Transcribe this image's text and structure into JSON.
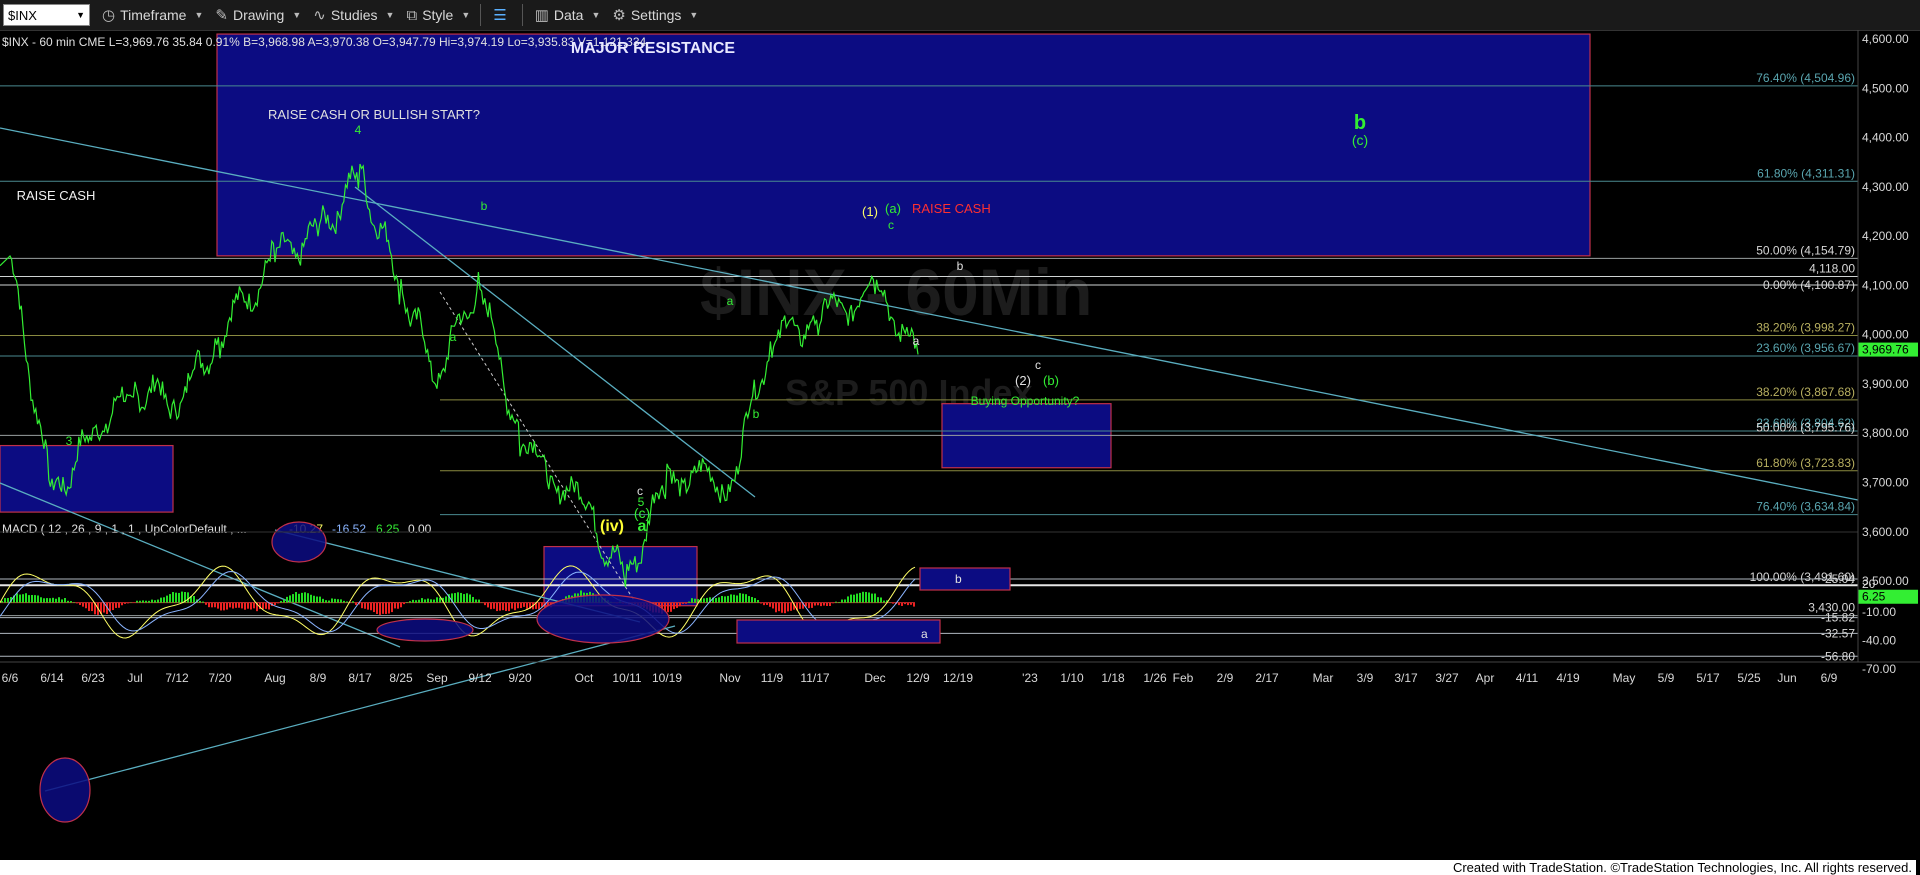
{
  "toolbar": {
    "symbol": "$INX",
    "timeframe": "Timeframe",
    "drawing": "Drawing",
    "studies": "Studies",
    "style": "Style",
    "data": "Data",
    "settings": "Settings"
  },
  "header": "$INX - 60 min CME  L=3,969.76  35.84  0.91%  B=3,968.98  A=3,970.38  O=3,947.79  Hi=3,974.19  Lo=3,935.83  V=1,121,334",
  "watermark": {
    "line1": "$INX - 60Min",
    "line2": "S&P 500 Index"
  },
  "colors": {
    "price": "#33ee33",
    "zone": "#0c0c82",
    "trend": "#5aaec0",
    "fib": "#4a7a84"
  },
  "annotations": {
    "major_resistance": "MAJOR RESISTANCE",
    "raise_cash_or_bullish": "RAISE CASH OR BULLISH START?",
    "raise_cash_left": "RAISE CASH",
    "raise_cash_right": "RAISE CASH",
    "buying_opportunity": "Buying Opportunity?",
    "w_4": "4",
    "w_3": "3",
    "w_b_sep": "b",
    "w_a_sep": "a",
    "w_c_oct": "c",
    "w_5_oct": "5",
    "w_c_paren_oct": "(c)",
    "w_iv": "(iv)",
    "w_a_big": "a",
    "w_a_nov": "a",
    "w_b_nov": "b",
    "w_1_paren": "(1)",
    "w_a_paren": "(a)",
    "w_c_dec": "c",
    "w_b_dec": "b",
    "w_a_dec": "a",
    "w_c_box": "c",
    "w_2_paren": "(2)",
    "w_b_paren": "(b)",
    "w_b_big": "b",
    "w_c_paren_big": "(c)"
  },
  "fibs": [
    {
      "label": "76.40% (4,504.96)",
      "value": 4504.96
    },
    {
      "label": "61.80% (4,311.31)",
      "value": 4311.31
    },
    {
      "label": "50.00% (4,154.79)",
      "value": 4154.79
    },
    {
      "label": "0.00% (4,100.87)",
      "value": 4100.87
    },
    {
      "label": "38.20% (3,998.27)",
      "value": 3998.27
    },
    {
      "label": "23.60% (3,956.67)",
      "value": 3956.67
    },
    {
      "label": "38.20% (3,867.68)",
      "value": 3867.68
    },
    {
      "label": "23.60% (3,804.62)",
      "value": 3804.62
    },
    {
      "label": "50.00% (3,795.76)",
      "value": 3795.76
    },
    {
      "label": "61.80% (3,723.83)",
      "value": 3723.83
    },
    {
      "label": "76.40% (3,634.84)",
      "value": 3634.84
    },
    {
      "label": "100.00% (3,491.60)",
      "value": 3491.6
    },
    {
      "label": "3,430.00",
      "value": 3430.0
    },
    {
      "label": "4,118.00",
      "value": 4118.0
    }
  ],
  "macd": {
    "title": "MACD ( 12 , 26 , 9 , 1 , 1 , UpColorDefault , ...",
    "v1": "-10.27",
    "v2": "-16.52",
    "v3": "6.25",
    "v4": "0.00",
    "levels": [
      {
        "label": "25.04",
        "value": 25.04
      },
      {
        "label": "-15.82",
        "value": -15.82
      },
      {
        "label": "-32.57",
        "value": -32.57
      },
      {
        "label": "-56.80",
        "value": -56.8
      }
    ],
    "box_b": "b",
    "box_a": "a",
    "ticks": [
      {
        "label": "20",
        "value": 20
      },
      {
        "label": "-10.00",
        "value": -10
      },
      {
        "label": "-40.00",
        "value": -40
      },
      {
        "label": "-70.00",
        "value": -70
      }
    ],
    "current": "6.25",
    "current_value": 6.25
  },
  "chart_data": {
    "type": "line",
    "title": "",
    "last_price_label": "3,969.76",
    "last_price": 3969.76,
    "y_ticks": [
      {
        "label": "4,600.00",
        "value": 4600
      },
      {
        "label": "4,500.00",
        "value": 4500
      },
      {
        "label": "4,400.00",
        "value": 4400
      },
      {
        "label": "4,300.00",
        "value": 4300
      },
      {
        "label": "4,200.00",
        "value": 4200
      },
      {
        "label": "4,100.00",
        "value": 4100
      },
      {
        "label": "4,000.00",
        "value": 4000
      },
      {
        "label": "3,900.00",
        "value": 3900
      },
      {
        "label": "3,800.00",
        "value": 3800
      },
      {
        "label": "3,700.00",
        "value": 3700
      },
      {
        "label": "3,600.00",
        "value": 3600
      },
      {
        "label": "3,500.00",
        "value": 3500
      }
    ],
    "x_labels": [
      "6/6",
      "6/14",
      "6/23",
      "Jul",
      "7/12",
      "7/20",
      "Aug",
      "8/9",
      "8/17",
      "8/25",
      "Sep",
      "9/12",
      "9/20",
      "Oct",
      "10/11",
      "10/19",
      "Nov",
      "11/9",
      "11/17",
      "Dec",
      "12/9",
      "12/19",
      "'23",
      "1/10",
      "1/18",
      "1/26",
      "Feb",
      "2/9",
      "2/17",
      "Mar",
      "3/9",
      "3/17",
      "3/27",
      "Apr",
      "4/11",
      "4/19",
      "May",
      "5/9",
      "5/17",
      "5/25",
      "Jun",
      "6/9"
    ],
    "ylim": [
      3380,
      4625
    ],
    "price_path_dates": [
      "6/6",
      "6/14",
      "6/23",
      "Jul",
      "7/12",
      "7/20",
      "Aug",
      "8/9",
      "8/17",
      "8/25",
      "Sep",
      "9/12",
      "9/20",
      "Oct",
      "10/11",
      "10/19",
      "Nov",
      "11/9",
      "11/17",
      "Dec",
      "12/9"
    ],
    "price_path_values": [
      4160,
      3665,
      3800,
      3890,
      3870,
      4000,
      4155,
      4200,
      4325,
      4100,
      3920,
      4110,
      3780,
      3650,
      3495,
      3720,
      3700,
      4000,
      4025,
      4095,
      3960
    ],
    "zones": [
      {
        "name": "major-resistance",
        "from": "7/20",
        "to": "4/19",
        "low": 4160,
        "high": 4610
      },
      {
        "name": "wave-3-box",
        "from": "6/6",
        "to": "7/12",
        "low": 3640,
        "high": 3775
      },
      {
        "name": "wave-c-bottom-box",
        "from": "Oct",
        "to": "10/19",
        "low": 3450,
        "high": 3570
      },
      {
        "name": "buying-opportunity",
        "from": "12/9",
        "to": "1/26",
        "low": 3730,
        "high": 3860
      }
    ]
  },
  "footer": "Created with TradeStation. ©TradeStation Technologies, Inc. All rights reserved."
}
